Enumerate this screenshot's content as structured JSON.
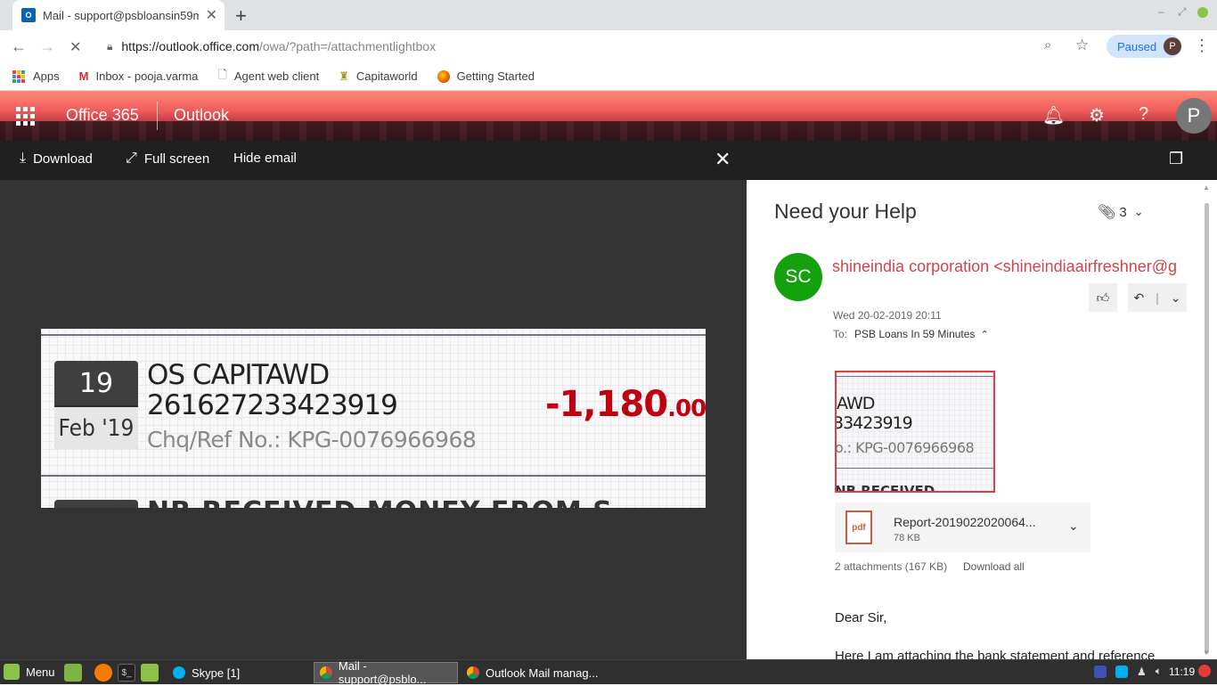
{
  "browser": {
    "tab_title": "Mail - support@psbloansin59m",
    "tab_favicon": "O",
    "new_tab": "+",
    "url_host": "https://outlook.office.com",
    "url_path": "/owa/?path=/attachmentlightbox",
    "profile_label": "Paused",
    "profile_initial": "P"
  },
  "bookmarks": [
    {
      "label": "Apps",
      "icon": "apps-grid-icon"
    },
    {
      "label": "Inbox - pooja.varma",
      "icon": "gmail-icon"
    },
    {
      "label": "Agent web client",
      "icon": "page-icon"
    },
    {
      "label": "Capitaworld",
      "icon": "capitaworld-icon"
    },
    {
      "label": "Getting Started",
      "icon": "firefox-icon"
    }
  ],
  "banner": {
    "brand": "Office 365",
    "app": "Outlook",
    "avatar_initial": "P"
  },
  "lightbox": {
    "download": "Download",
    "fullscreen": "Full screen",
    "hide_email": "Hide email"
  },
  "statement": {
    "day": "19",
    "month": "Feb '19",
    "name": "OS CAPITAWD",
    "account": "261627233423919",
    "ref": "Chq/Ref No.: KPG-0076966968",
    "amount_main": "-1,180",
    "amount_dec": ".00",
    "next_line": "NB RECEIVED MONEY FROM S"
  },
  "email": {
    "subject": "Need your Help",
    "attachment_count": "3",
    "sender_initials": "SC",
    "sender": "shineindia corporation <shineindiaairfreshner@g",
    "date": "Wed 20-02-2019 20:11",
    "to_label": "To:",
    "to_value": "PSB Loans In 59 Minutes",
    "thumb_lines": [
      "AWD",
      "33423919",
      "o.: KPG-0076966968",
      "NB RECEIVED MONEY FROM S"
    ],
    "file_name": "Report-2019022020064...",
    "file_size": "78 KB",
    "pdf_label": "pdf",
    "attachments_summary": "2 attachments (167 KB)",
    "download_all": "Download all",
    "greeting": "Dear Sir,",
    "body": "Here I am attaching the bank statement and reference"
  },
  "taskbar": {
    "menu": "Menu",
    "tasks": [
      "Skype [1]",
      "Mail - support@psblo...",
      "Outlook Mail manag..."
    ],
    "clock": "11:19"
  }
}
